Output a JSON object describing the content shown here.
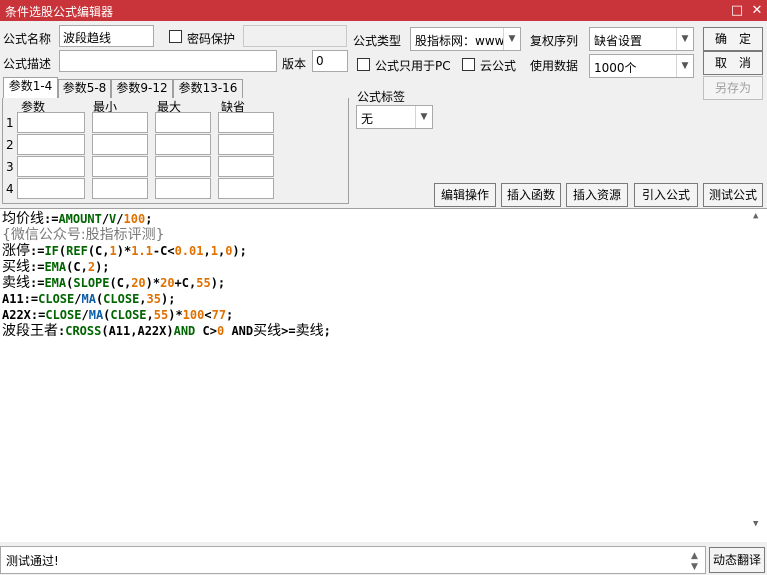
{
  "window": {
    "title": "条件选股公式编辑器",
    "maximize_glyph": "□",
    "close_glyph": "✕"
  },
  "form": {
    "name_label": "公式名称",
    "name_value": "波段趋线",
    "password_label": "密码保护",
    "desc_label": "公式描述",
    "desc_value": "",
    "version_label": "版本",
    "version_value": "0",
    "type_label": "公式类型",
    "type_value": "股指标网：www",
    "pc_only_label": "公式只用于PC",
    "cloud_label": "云公式",
    "adjust_label": "复权序列",
    "adjust_value": "缺省设置",
    "data_label": "使用数据",
    "data_value": "1000个",
    "tag_label": "公式标签",
    "tag_value": "无"
  },
  "buttons": {
    "ok": "确　定",
    "cancel": "取　消",
    "save_as": "另存为",
    "edit_ops": "编辑操作",
    "insert_func": "插入函数",
    "insert_res": "插入资源",
    "import": "引入公式",
    "test": "测试公式",
    "translate": "动态翻译"
  },
  "tabs": [
    {
      "label": "参数1-4"
    },
    {
      "label": "参数5-8"
    },
    {
      "label": "参数9-12"
    },
    {
      "label": "参数13-16"
    }
  ],
  "params": {
    "headers": [
      "参数",
      "最小",
      "最大",
      "缺省"
    ],
    "rows": [
      "1",
      "2",
      "3",
      "4"
    ]
  },
  "code": {
    "l1": {
      "a": "均价线",
      "b": ":=",
      "c": "AMOUNT",
      "d": "/",
      "e": "V",
      "f": "/",
      "g": "100",
      "h": ";"
    },
    "l2": {
      "text": "{微信公众号:股指标评测}"
    },
    "l3": {
      "a": "涨停",
      "b": ":=",
      "c": "IF",
      "d": "(",
      "e": "REF",
      "f": "(C,",
      "g": "1",
      "h": ")*",
      "i": "1.1",
      "j": "-C<",
      "k": "0.01",
      "l": ",",
      "m": "1",
      "n": ",",
      "o": "0",
      "p": ");"
    },
    "l4": {
      "a": "买线",
      "b": ":=",
      "c": "EMA",
      "d": "(C,",
      "e": "2",
      "f": ");"
    },
    "l5": {
      "a": "卖线",
      "b": ":=",
      "c": "EMA",
      "d": "(",
      "e": "SLOPE",
      "f": "(C,",
      "g": "20",
      "h": ")*",
      "i": "20",
      "j": "+C,",
      "k": "55",
      "l": ");"
    },
    "l6": {
      "a": "A11:=",
      "b": "CLOSE",
      "c": "/",
      "d": "MA",
      "e": "(",
      "f": "CLOSE",
      "g": ",",
      "h": "35",
      "i": ");"
    },
    "l7": {
      "a": "A22X:=",
      "b": "CLOSE",
      "c": "/",
      "d": "MA",
      "e": "(",
      "f": "CLOSE",
      "g": ",",
      "h": "55",
      "i": ")*",
      "j": "100",
      "k": "<",
      "l": "77",
      "m": ";"
    },
    "l8": {
      "a": "波段王者",
      "b": ":",
      "c": "CROSS",
      "d": "(A11,A22X)",
      "e": "AND",
      "f": " C>",
      "g": "0",
      "h": " ",
      "i": "AND",
      "j": "买线",
      "k": ">=",
      "l": "卖线",
      "m": ";"
    }
  },
  "status": {
    "text": "测试通过!"
  },
  "icons": {
    "dropdown": "chevron-down-icon",
    "scroll_up": "▲",
    "scroll_down": "▼",
    "scroll_down2": "˅"
  }
}
